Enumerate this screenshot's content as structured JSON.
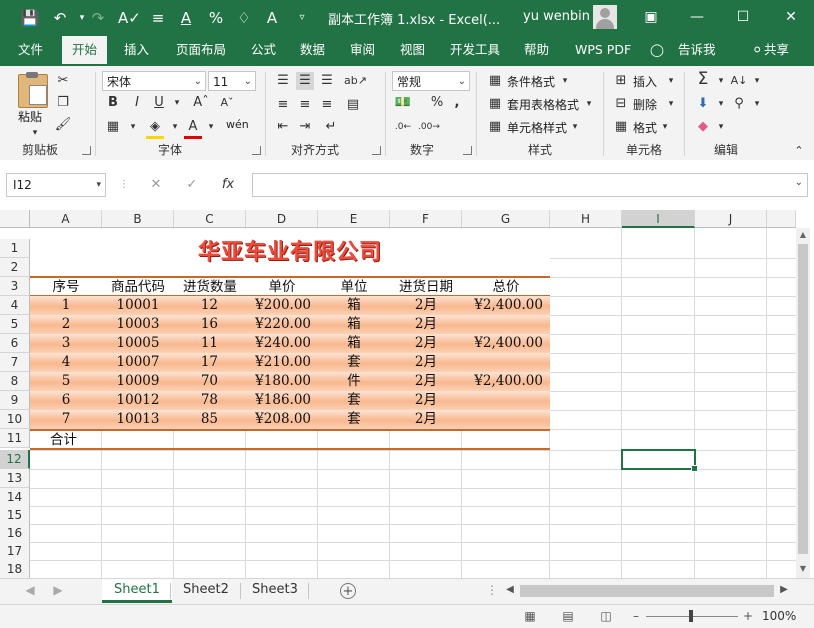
{
  "titlebar": {
    "doc_title": "副本工作簿 1.xlsx  -  Excel(...",
    "user": "yu wenbin",
    "icons": [
      "save-icon",
      "undo-icon",
      "redo-icon",
      "spell-icon",
      "align-icon",
      "font-color-icon",
      "percent-icon",
      "tag-icon",
      "font-a-icon",
      "more-icon"
    ]
  },
  "tabs": [
    "文件",
    "开始",
    "插入",
    "页面布局",
    "公式",
    "数据",
    "审阅",
    "视图",
    "开发工具",
    "帮助",
    "WPS PDF",
    "告诉我",
    "共享"
  ],
  "ribbon": {
    "paste_label": "粘贴",
    "clipboard_label": "剪贴板",
    "font_name": "宋体",
    "font_size": "11",
    "bold": "B",
    "italic": "I",
    "underline": "U",
    "font_label": "字体",
    "align_label": "对齐方式",
    "wen": "wén",
    "number_format": "常规",
    "number_label": "数字",
    "cond_format": "条件格式",
    "table_format": "套用表格格式",
    "cell_style": "单元格样式",
    "styles_label": "样式",
    "insert": "插入",
    "delete": "删除",
    "format": "格式",
    "cells_label": "单元格",
    "edit_label": "编辑"
  },
  "formula_bar": {
    "name_box": "I12",
    "fx": "fx",
    "formula": ""
  },
  "grid": {
    "columns": [
      "A",
      "B",
      "C",
      "D",
      "E",
      "F",
      "G",
      "H",
      "I",
      "J"
    ],
    "rows": [
      "1",
      "2",
      "3",
      "4",
      "5",
      "6",
      "7",
      "8",
      "9",
      "10",
      "11",
      "12",
      "13",
      "14",
      "15",
      "16",
      "17",
      "18"
    ],
    "selected_cell": "I12",
    "company": "华亚车业有限公司",
    "headers": [
      "序号",
      "商品代码",
      "进货数量",
      "单价",
      "单位",
      "进货日期",
      "总价"
    ],
    "data": [
      [
        "1",
        "10001",
        "12",
        "¥200.00",
        "箱",
        "2月",
        "¥2,400.00"
      ],
      [
        "2",
        "10003",
        "16",
        "¥220.00",
        "箱",
        "2月",
        ""
      ],
      [
        "3",
        "10005",
        "11",
        "¥240.00",
        "箱",
        "2月",
        "¥2,400.00"
      ],
      [
        "4",
        "10007",
        "17",
        "¥210.00",
        "套",
        "2月",
        ""
      ],
      [
        "5",
        "10009",
        "70",
        "¥180.00",
        "件",
        "2月",
        "¥2,400.00"
      ],
      [
        "6",
        "10012",
        "78",
        "¥186.00",
        "套",
        "2月",
        ""
      ],
      [
        "7",
        "10013",
        "85",
        "¥208.00",
        "套",
        "2月",
        ""
      ]
    ],
    "total_label": "合计"
  },
  "sheets": [
    "Sheet1",
    "Sheet2",
    "Sheet3"
  ],
  "active_sheet": "Sheet1",
  "status": {
    "zoom": "100%"
  }
}
